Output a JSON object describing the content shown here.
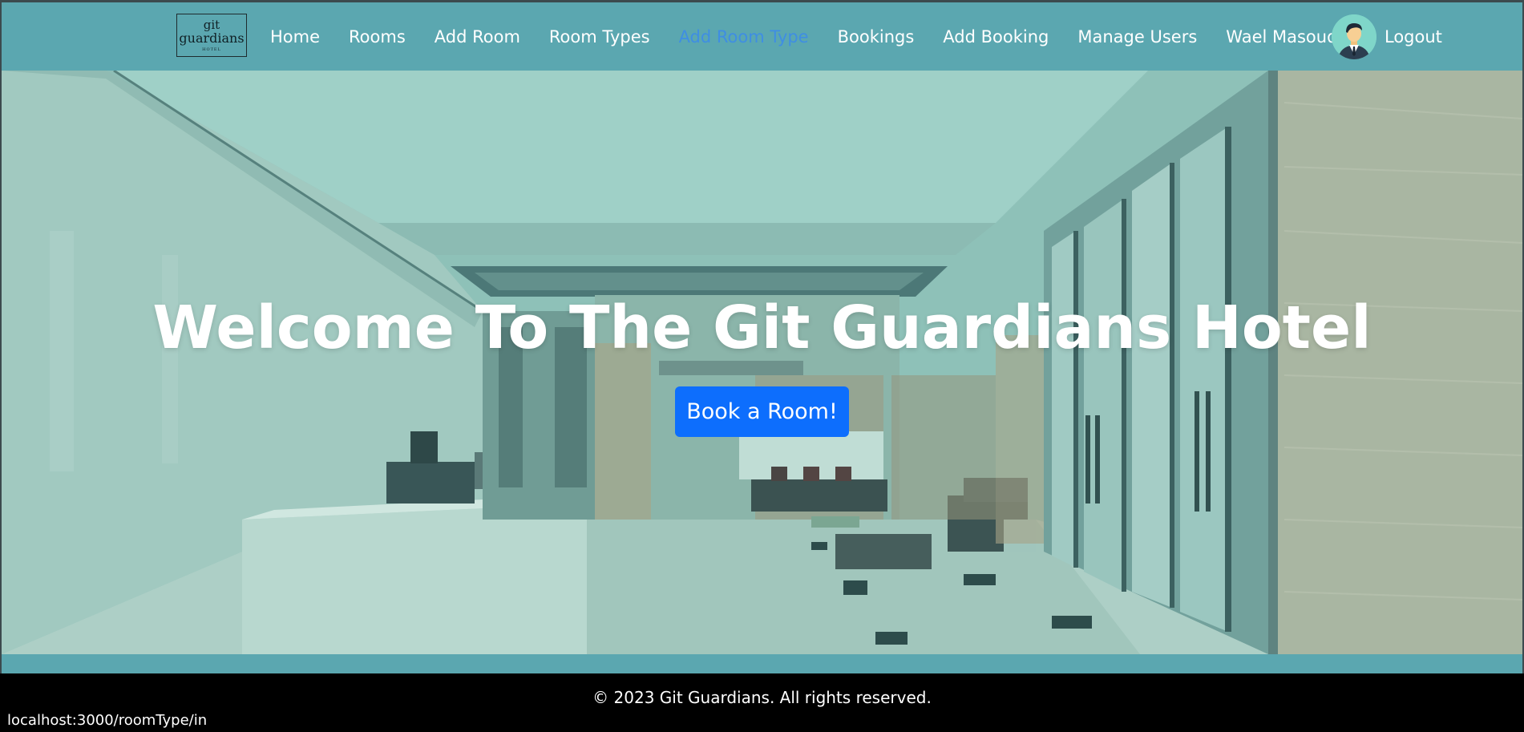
{
  "logo": {
    "line1": "git",
    "line2": "guardians",
    "line3": "HOTEL"
  },
  "nav": {
    "items": [
      {
        "label": "Home",
        "active": false
      },
      {
        "label": "Rooms",
        "active": false
      },
      {
        "label": "Add Room",
        "active": false
      },
      {
        "label": "Room Types",
        "active": false
      },
      {
        "label": "Add Room Type",
        "active": true
      },
      {
        "label": "Bookings",
        "active": false
      },
      {
        "label": "Add Booking",
        "active": false
      },
      {
        "label": "Manage Users",
        "active": false
      },
      {
        "label": "Wael Masoud",
        "active": false
      }
    ],
    "avatar_icon": "user-avatar-icon",
    "logout_label": "Logout"
  },
  "hero": {
    "title": "Welcome To The Git Guardians Hotel",
    "cta_label": "Book a Room!"
  },
  "footer": {
    "copyright": "© 2023 Git Guardians. All rights reserved."
  },
  "status_bar": {
    "url": "localhost:3000/roomType/in"
  },
  "colors": {
    "navbar": "#5ba7b0",
    "active_link": "#3f8ee3",
    "cta": "#0d6efd",
    "footer": "#000000"
  }
}
